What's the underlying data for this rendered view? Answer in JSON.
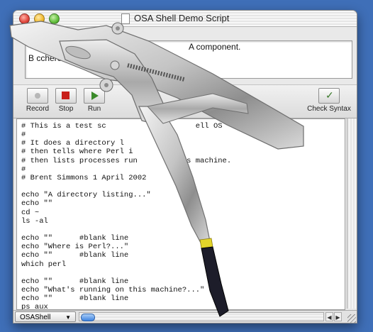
{
  "window": {
    "title": "OSA Shell Demo Script"
  },
  "description": {
    "line1": "A component.",
    "line2": "B                                     cchero.com/software/osashell/"
  },
  "toolbar": {
    "record_label": "Record",
    "stop_label": "Stop",
    "run_label": "Run",
    "check_label": "Check Syntax"
  },
  "script": {
    "lines": [
      "# This is a test sc                    ell OS",
      "#",
      "# It does a directory l",
      "# then tells where Perl i",
      "# then lists processes run         his machine.",
      "#",
      "# Brent Simmons 1 April 2002",
      "",
      "echo \"A directory listing...\"",
      "echo \"\"",
      "cd ~",
      "ls -al",
      "",
      "echo \"\"      #blank line",
      "echo \"Where is Perl?...\"",
      "echo \"\"      #blank line",
      "which perl",
      "",
      "echo \"\"      #blank line",
      "echo \"What's running on this machine?...\"",
      "echo \"\"      #blank line",
      "ps aux"
    ]
  },
  "bottom": {
    "language": "OSAShell"
  },
  "colors": {
    "desktop": "#3f6fb8",
    "stop_red": "#c8201a",
    "scroll_blue": "#3e84e0"
  }
}
